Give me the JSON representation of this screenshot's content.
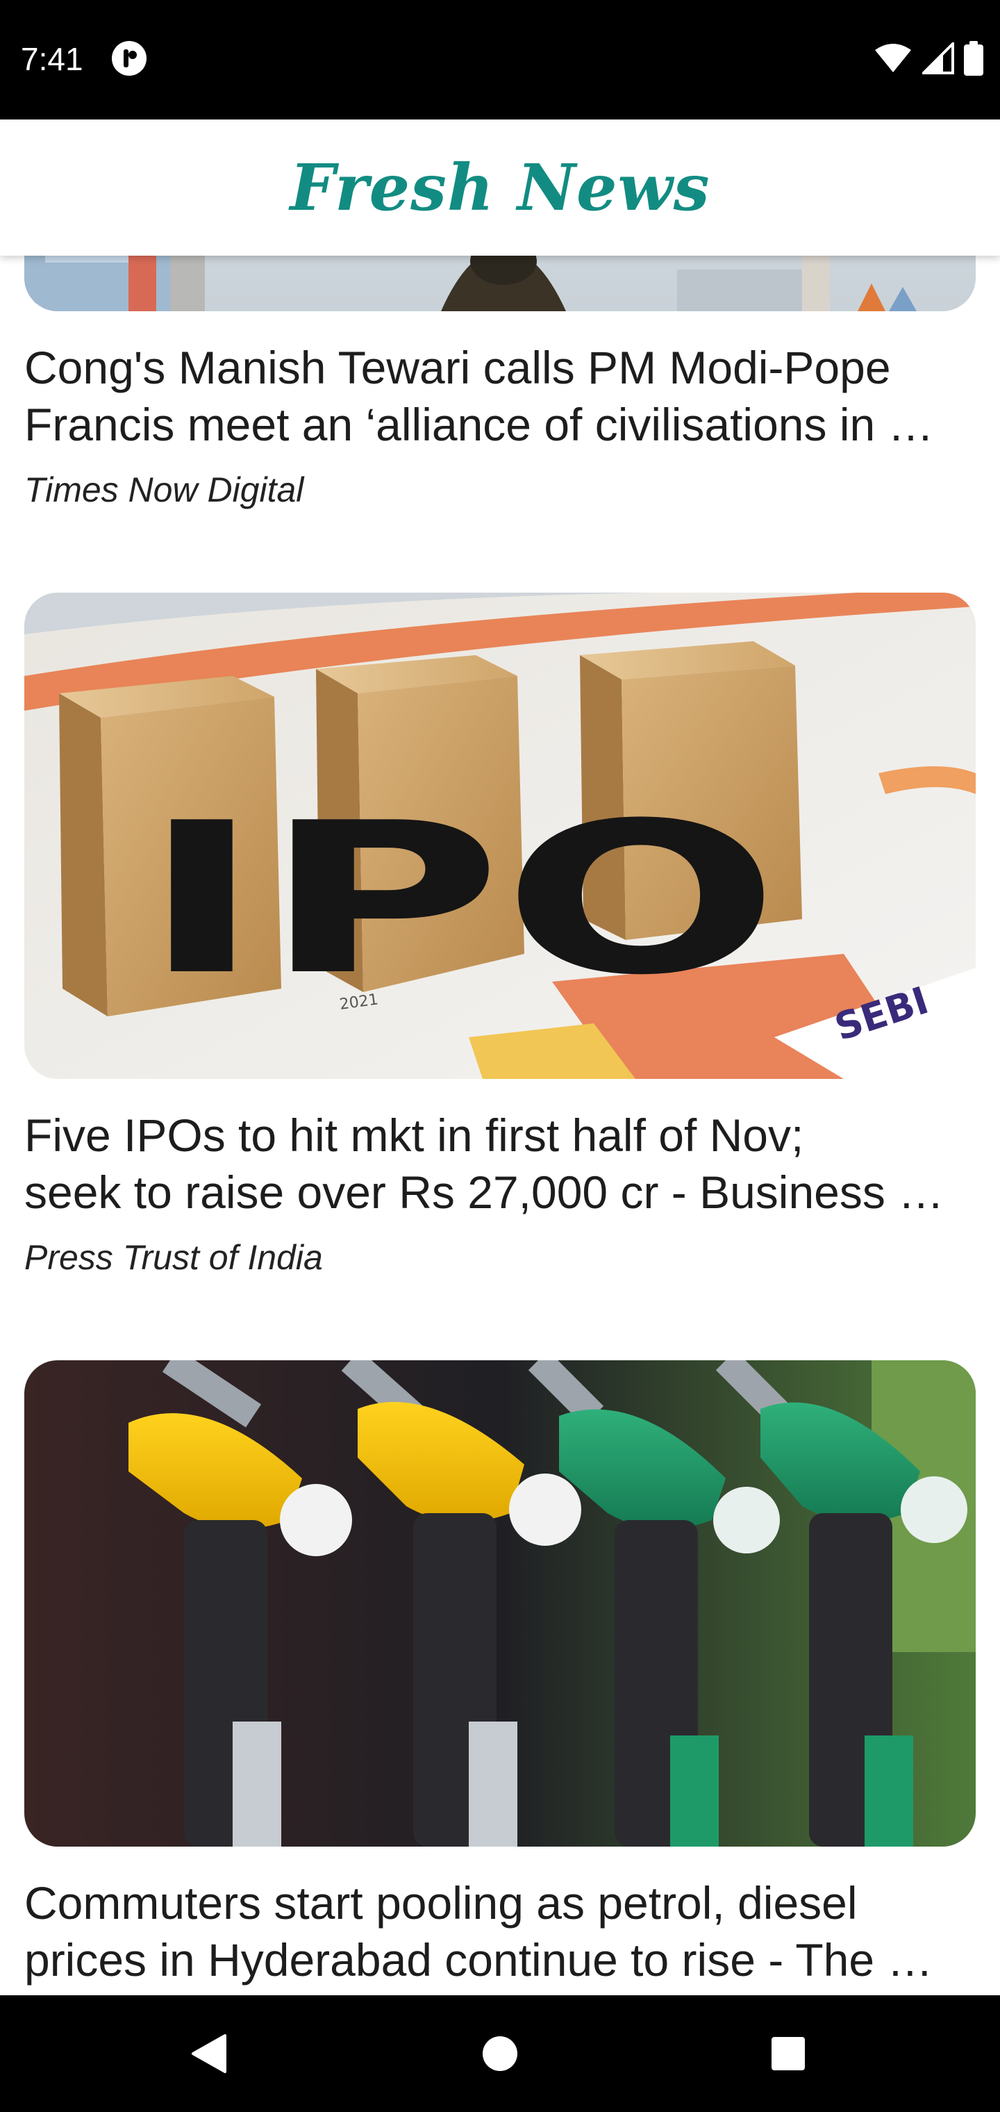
{
  "status_bar": {
    "time": "7:41",
    "notification_icon": "app-notification-icon",
    "wifi_icon": "wifi-icon",
    "signal_icon": "cell-signal-icon",
    "battery_icon": "battery-icon"
  },
  "app_bar": {
    "title": "Fresh News"
  },
  "articles": [
    {
      "title_line1": "Cong's Manish Tewari calls PM Modi-Pope",
      "title_line2": "Francis meet an ‘alliance of civilisations in …",
      "source": "Times Now Digital",
      "image": "news-photo-soldier"
    },
    {
      "title_line1": "Five IPOs to hit mkt in first half of Nov;",
      "title_line2": "seek to raise over Rs 27,000 cr - Business …",
      "source": "Press Trust of India",
      "image": "ipo-wooden-blocks",
      "image_text": "IPO"
    },
    {
      "title_line1": "Commuters start pooling as petrol, diesel",
      "title_line2": "prices in Hyderabad continue to rise - The …",
      "source": "",
      "image": "fuel-pump-nozzles"
    }
  ],
  "nav_bar": {
    "back_icon": "back-triangle-icon",
    "home_icon": "home-circle-icon",
    "recents_icon": "recents-square-icon"
  },
  "colors": {
    "brand": "#128c82",
    "status_bar": "#000000",
    "nav_bar": "#000000",
    "text": "#1d1d1d"
  }
}
